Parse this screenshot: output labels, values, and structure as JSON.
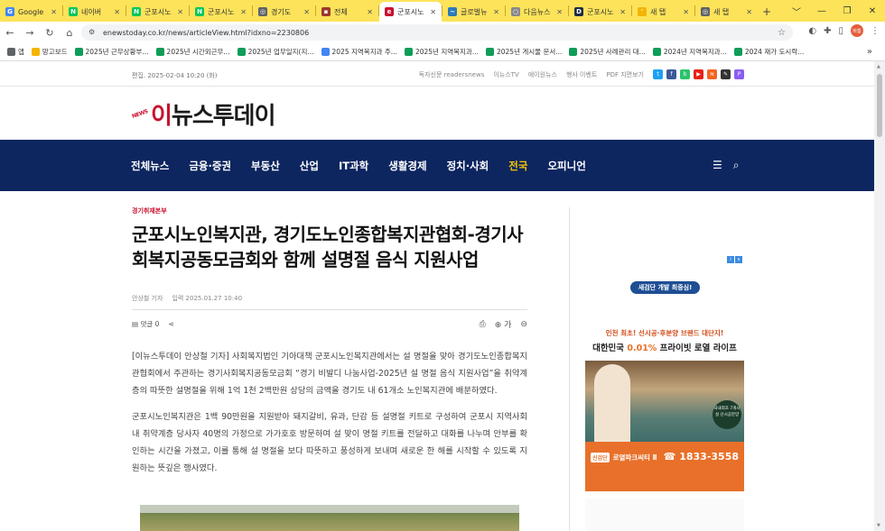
{
  "browser": {
    "tabs": [
      {
        "label": "Google",
        "icon": "google-icon",
        "color": "#4285f4",
        "glyph": "G",
        "active": false
      },
      {
        "label": "네이버",
        "icon": "naver-icon",
        "color": "#03c75a",
        "glyph": "N",
        "active": false
      },
      {
        "label": "군포시노",
        "icon": "naver-icon",
        "color": "#03c75a",
        "glyph": "N",
        "active": false
      },
      {
        "label": "군포시노",
        "icon": "naver-icon",
        "color": "#03c75a",
        "glyph": "N",
        "active": false
      },
      {
        "label": "경기도",
        "icon": "globe-icon",
        "color": "#5f6368",
        "glyph": "◎",
        "active": false
      },
      {
        "label": "전체",
        "icon": "news-icon",
        "color": "#9b3a2b",
        "glyph": "▪",
        "active": false
      },
      {
        "label": "군포시노",
        "icon": "enews-icon",
        "color": "#c8102e",
        "glyph": "e",
        "active": true
      },
      {
        "label": "글로벌뉴",
        "icon": "wave-icon",
        "color": "#2b7bb9",
        "glyph": "~",
        "active": false
      },
      {
        "label": "다음뉴스",
        "icon": "loading-icon",
        "color": "#888888",
        "glyph": "○",
        "active": false
      },
      {
        "label": "군포시노",
        "icon": "d-icon",
        "color": "#1f2a44",
        "glyph": "D",
        "active": false
      },
      {
        "label": "새 탭",
        "icon": "newtab-icon",
        "color": "#f4b400",
        "glyph": "'",
        "active": false
      },
      {
        "label": "새 탭",
        "icon": "globe-icon",
        "color": "#5f6368",
        "glyph": "◎",
        "active": false
      }
    ],
    "new_tab_label": "+",
    "window_controls": [
      "﹀",
      "—",
      "❐",
      "✕"
    ],
    "url": "enewstoday.co.kr/news/articleView.html?idxno=2230806",
    "profile_label": "바쁨",
    "bookmarks": [
      {
        "label": "앱",
        "color": "#5f6368"
      },
      {
        "label": "망고보드",
        "color": "#f4b400"
      },
      {
        "label": "2025년 근무상황부...",
        "color": "#0f9d58"
      },
      {
        "label": "2025년 시간외근무...",
        "color": "#0f9d58"
      },
      {
        "label": "2025년 업무일지(지...",
        "color": "#0f9d58"
      },
      {
        "label": "2025 지역복지과 주...",
        "color": "#4285f4"
      },
      {
        "label": "2025년 지역복지과...",
        "color": "#0f9d58"
      },
      {
        "label": "2025년 게시물 문서...",
        "color": "#0f9d58"
      },
      {
        "label": "2025년 사례관리 대...",
        "color": "#0f9d58"
      },
      {
        "label": "2024년 지역복지과...",
        "color": "#0f9d58"
      },
      {
        "label": "2024 재가 도시락...",
        "color": "#0f9d58"
      }
    ],
    "bookmarks_more": "»"
  },
  "site": {
    "edit_date": "편집. 2025-02-04 10:20 (화)",
    "top_links": [
      "독자신문 readersnews",
      "이뉴스TV",
      "에이원뉴스",
      "행사 이벤트",
      "PDF 지면보기"
    ],
    "sns": [
      {
        "name": "twitter-icon",
        "color": "#1da1f2",
        "glyph": "t"
      },
      {
        "name": "facebook-icon",
        "color": "#3b5998",
        "glyph": "f"
      },
      {
        "name": "naver-band-icon",
        "color": "#2bc26b",
        "glyph": "b"
      },
      {
        "name": "youtube-icon",
        "color": "#e62117",
        "glyph": "▶"
      },
      {
        "name": "rss-icon",
        "color": "#f26522",
        "glyph": "≋"
      },
      {
        "name": "blog-icon",
        "color": "#333333",
        "glyph": "✎"
      },
      {
        "name": "post-icon",
        "color": "#8b5cf6",
        "glyph": "P"
      }
    ],
    "logo_badge": "NEWS",
    "logo_prefix": "이",
    "logo_text": "뉴스투데이",
    "nav": [
      {
        "label": "전체뉴스",
        "highlight": false
      },
      {
        "label": "금융·증권",
        "highlight": false
      },
      {
        "label": "부동산",
        "highlight": false
      },
      {
        "label": "산업",
        "highlight": false
      },
      {
        "label": "IT과학",
        "highlight": false
      },
      {
        "label": "생활경제",
        "highlight": false
      },
      {
        "label": "정치·사회",
        "highlight": false
      },
      {
        "label": "전국",
        "highlight": true
      },
      {
        "label": "오피니언",
        "highlight": false
      }
    ]
  },
  "article": {
    "section": "경기취재본부",
    "title": "군포시노인복지관, 경기도노인종합복지관협회-경기사회복지공동모금회와 함께 설명절 음식 지원사업",
    "author": "안상철 기자",
    "published": "입력 2025.01.27 10:40",
    "comments": "댓글 0",
    "font_plus": "가",
    "paragraphs": [
      "[이뉴스투데이 안상철 기자] 사회복지법인 기아대책 군포시노인복지관에서는 설 명절을 맞아 경기도노인종합복지관협회에서 주관하는 경기사회복지공동모금회 “경기 비발디 나눔사업-2025년 설 명절 음식 지원사업”을 취약계층의 따뜻한 설명절을 위해 1억 1천 2백만원 상당의 금액을 경기도 내 61개소 노인복지관에 배분하였다.",
      "군포시노인복지관은 1백 90만원을 지원받아 돼지갈비, 유과, 단감 등 설명절 키트로 구성하여 군포시 지역사회 내 취약계층 당사자 40명의 가정으로 가가호호 방문하여 설 맞이 명절 키트를 전달하고 대화를 나누며 안부를 확인하는 시간을 가졌고, 이를 통해 설 명절을 보다 따뜻하고 풍성하게 보내며 새로운 한 해를 시작할 수 있도록 지원하는 뜻깊은 행사였다."
    ]
  },
  "ad": {
    "pill": "새검단 개발 최중심!",
    "line1": "인천 최초! 선시공·후분양 브랜드 대단지!",
    "line2a": "대한민국 ",
    "line2b": "0.01%",
    "line2c": " 프라이빗 로열 라이프",
    "circle": "국내최초 7개시설 선시공분양",
    "tag": "신검단",
    "brand": "로열파크씨티 Ⅱ",
    "phone": "1833-3558"
  }
}
